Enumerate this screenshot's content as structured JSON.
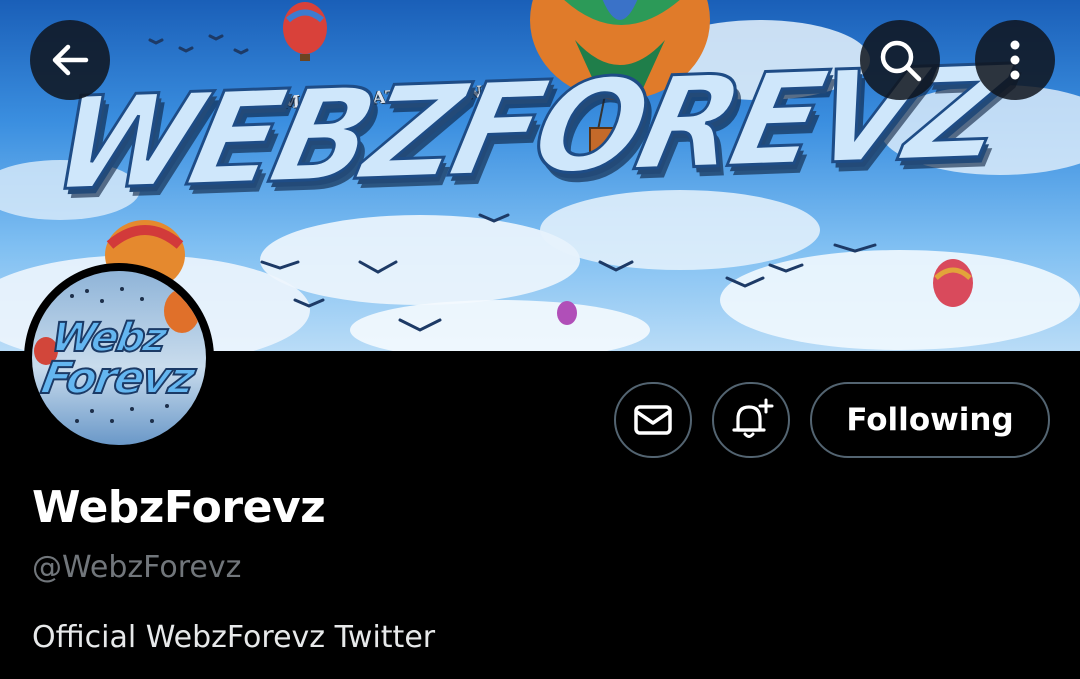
{
  "banner": {
    "tagline": "ANIMATION AT ITS FINEST",
    "title": "WEBZFOREVZ"
  },
  "avatar": {
    "line1": "Webz",
    "line2": "Forevz"
  },
  "header_buttons": {
    "back_icon": "back-arrow-icon",
    "search_icon": "search-icon",
    "more_icon": "more-vertical-icon"
  },
  "actions": {
    "message_icon": "mail-icon",
    "notify_icon": "bell-plus-icon",
    "following_label": "Following"
  },
  "profile": {
    "name": "WebzForevz",
    "handle": "@WebzForevz",
    "bio": "Official WebzForevz Twitter"
  },
  "colors": {
    "background": "#000000",
    "border": "#536471",
    "handle": "#71767b"
  }
}
